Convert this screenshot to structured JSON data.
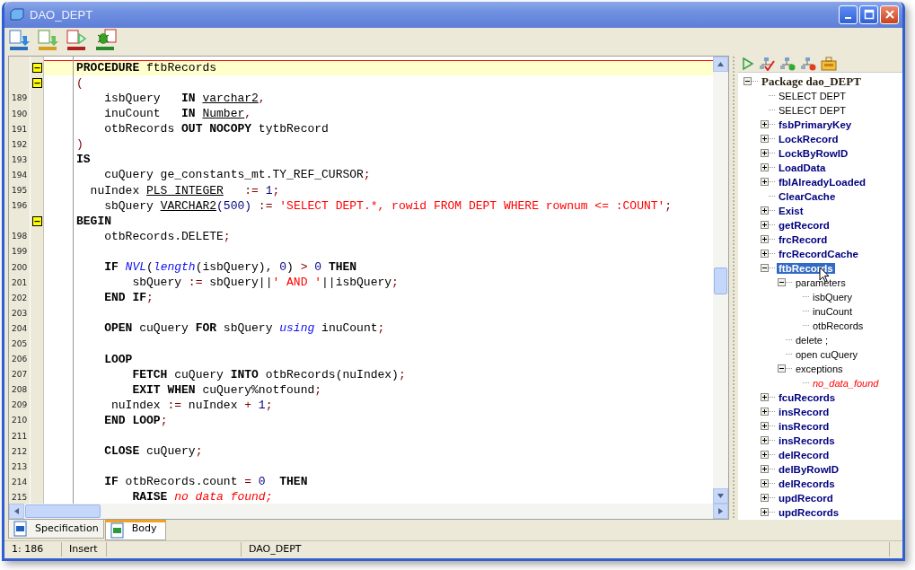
{
  "window": {
    "title": "DAO_DEPT"
  },
  "editor": {
    "lines": [
      {
        "fold": true,
        "current": true,
        "tokens": [
          {
            "kind": "keyword",
            "t": "PROCEDURE"
          },
          {
            "kind": "identifier",
            "t": " ftbRecords"
          }
        ]
      },
      {
        "fold": true,
        "current": false,
        "tokens": [
          {
            "kind": "operator",
            "t": "("
          }
        ]
      },
      {
        "number": "189",
        "tokens": [
          {
            "kind": "identifier",
            "t": "    isbQuery   "
          },
          {
            "kind": "keyword",
            "t": "IN "
          },
          {
            "kind": "datatype",
            "t": "varchar2"
          },
          {
            "kind": "operator",
            "t": ","
          }
        ]
      },
      {
        "number": "190",
        "tokens": [
          {
            "kind": "identifier",
            "t": "    inuCount   "
          },
          {
            "kind": "keyword",
            "t": "IN "
          },
          {
            "kind": "datatype",
            "t": "Number"
          },
          {
            "kind": "operator",
            "t": ","
          }
        ]
      },
      {
        "number": "191",
        "tokens": [
          {
            "kind": "identifier",
            "t": "    otbRecords "
          },
          {
            "kind": "keyword",
            "t": "OUT NOCOPY"
          },
          {
            "kind": "identifier",
            "t": " tytbRecord"
          }
        ]
      },
      {
        "number": "192",
        "tokens": [
          {
            "kind": "operator",
            "t": ")"
          }
        ]
      },
      {
        "number": "193",
        "tokens": [
          {
            "kind": "keyword",
            "t": "IS"
          }
        ]
      },
      {
        "number": "194",
        "tokens": [
          {
            "kind": "identifier",
            "t": "    cuQuery ge_constants_mt.TY_REF_CURSOR"
          },
          {
            "kind": "operator",
            "t": ";"
          }
        ]
      },
      {
        "number": "195",
        "tokens": [
          {
            "kind": "identifier",
            "t": "  nuIndex "
          },
          {
            "kind": "datatype",
            "t": "PLS_INTEGER"
          },
          {
            "kind": "operator",
            "t": "   := "
          },
          {
            "kind": "number",
            "t": "1"
          },
          {
            "kind": "operator",
            "t": ";"
          }
        ]
      },
      {
        "number": "196",
        "tokens": [
          {
            "kind": "identifier",
            "t": "    sbQuery "
          },
          {
            "kind": "datatype",
            "t": "VARCHAR2"
          },
          {
            "kind": "number",
            "t": "(500)"
          },
          {
            "kind": "operator",
            "t": " := "
          },
          {
            "kind": "string",
            "t": "'SELECT DEPT.*, rowid FROM DEPT WHERE rownum <= :COUNT'"
          },
          {
            "kind": "operator",
            "t": ";"
          }
        ]
      },
      {
        "fold": true,
        "current": false,
        "tokens": [
          {
            "kind": "keyword",
            "t": "BEGIN"
          }
        ]
      },
      {
        "number": "198",
        "tokens": [
          {
            "kind": "identifier",
            "t": "    otbRecords.DELETE"
          },
          {
            "kind": "operator",
            "t": ";"
          }
        ]
      },
      {
        "number": "199"
      },
      {
        "number": "200",
        "tokens": [
          {
            "kind": "keyword",
            "t": "    IF "
          },
          {
            "kind": "function",
            "t": "NVL"
          },
          {
            "kind": "identifier",
            "t": "("
          },
          {
            "kind": "function",
            "t": "length"
          },
          {
            "kind": "identifier",
            "t": "(isbQuery), "
          },
          {
            "kind": "number",
            "t": "0"
          },
          {
            "kind": "identifier",
            "t": ") "
          },
          {
            "kind": "operator",
            "t": "> "
          },
          {
            "kind": "number",
            "t": "0 "
          },
          {
            "kind": "keyword",
            "t": "THEN"
          }
        ]
      },
      {
        "number": "201",
        "tokens": [
          {
            "kind": "identifier",
            "t": "        sbQuery "
          },
          {
            "kind": "operator",
            "t": ":="
          },
          {
            "kind": "identifier",
            "t": " sbQuery||"
          },
          {
            "kind": "string",
            "t": "' AND '"
          },
          {
            "kind": "identifier",
            "t": "||isbQuery"
          },
          {
            "kind": "operator",
            "t": ";"
          }
        ]
      },
      {
        "number": "202",
        "tokens": [
          {
            "kind": "keyword",
            "t": "    END IF"
          },
          {
            "kind": "operator",
            "t": ";"
          }
        ]
      },
      {
        "number": "203"
      },
      {
        "number": "204",
        "tokens": [
          {
            "kind": "keyword",
            "t": "    OPEN"
          },
          {
            "kind": "identifier",
            "t": " cuQuery "
          },
          {
            "kind": "keyword",
            "t": "FOR"
          },
          {
            "kind": "identifier",
            "t": " sbQuery "
          },
          {
            "kind": "function",
            "t": "using"
          },
          {
            "kind": "identifier",
            "t": " inuCount"
          },
          {
            "kind": "operator",
            "t": ";"
          }
        ]
      },
      {
        "number": "205"
      },
      {
        "number": "206",
        "tokens": [
          {
            "kind": "keyword",
            "t": "    LOOP"
          }
        ]
      },
      {
        "number": "207",
        "tokens": [
          {
            "kind": "keyword",
            "t": "        FETCH"
          },
          {
            "kind": "identifier",
            "t": " cuQuery "
          },
          {
            "kind": "keyword",
            "t": "INTO"
          },
          {
            "kind": "identifier",
            "t": " otbRecords(nuIndex)"
          },
          {
            "kind": "operator",
            "t": ";"
          }
        ]
      },
      {
        "number": "208",
        "tokens": [
          {
            "kind": "keyword",
            "t": "        EXIT WHEN"
          },
          {
            "kind": "identifier",
            "t": " cuQuery%notfound"
          },
          {
            "kind": "operator",
            "t": ";"
          }
        ]
      },
      {
        "number": "209",
        "tokens": [
          {
            "kind": "identifier",
            "t": "     nuIndex "
          },
          {
            "kind": "operator",
            "t": ":="
          },
          {
            "kind": "identifier",
            "t": " nuIndex "
          },
          {
            "kind": "operator",
            "t": "+ "
          },
          {
            "kind": "number",
            "t": "1"
          },
          {
            "kind": "operator",
            "t": ";"
          }
        ]
      },
      {
        "number": "210",
        "tokens": [
          {
            "kind": "keyword",
            "t": "    END LOOP"
          },
          {
            "kind": "operator",
            "t": ";"
          }
        ]
      },
      {
        "number": "211"
      },
      {
        "number": "212",
        "tokens": [
          {
            "kind": "keyword",
            "t": "    CLOSE"
          },
          {
            "kind": "identifier",
            "t": " cuQuery"
          },
          {
            "kind": "operator",
            "t": ";"
          }
        ]
      },
      {
        "number": "213"
      },
      {
        "number": "214",
        "tokens": [
          {
            "kind": "keyword",
            "t": "    IF"
          },
          {
            "kind": "identifier",
            "t": " otbRecords.count "
          },
          {
            "kind": "operator",
            "t": "= "
          },
          {
            "kind": "number",
            "t": "0  "
          },
          {
            "kind": "keyword",
            "t": "THEN"
          }
        ]
      },
      {
        "number": "215",
        "tokens": [
          {
            "kind": "keyword",
            "t": "        RAISE "
          },
          {
            "kind": "exception",
            "t": "no data found;"
          }
        ]
      }
    ]
  },
  "tree": {
    "root": {
      "label": "Package dao_DEPT",
      "expanded": true,
      "children": [
        {
          "label": "SELECT DEPT",
          "kind": "plain",
          "selected": false
        },
        {
          "label": "SELECT DEPT",
          "kind": "plain",
          "selected": false
        },
        {
          "label": "fsbPrimaryKey",
          "kind": "method",
          "expanded": false,
          "selected": false
        },
        {
          "label": "LockRecord",
          "kind": "method",
          "expanded": false,
          "selected": false
        },
        {
          "label": "LockByRowID",
          "kind": "method",
          "expanded": false,
          "selected": false
        },
        {
          "label": "LoadData",
          "kind": "method",
          "expanded": false,
          "selected": false
        },
        {
          "label": "fblAlreadyLoaded",
          "kind": "method",
          "expanded": false,
          "selected": false
        },
        {
          "label": "ClearCache",
          "kind": "method",
          "selected": false
        },
        {
          "label": "Exist",
          "kind": "method",
          "expanded": false,
          "selected": false
        },
        {
          "label": "getRecord",
          "kind": "method",
          "expanded": false,
          "selected": false
        },
        {
          "label": "frcRecord",
          "kind": "method",
          "expanded": false,
          "selected": false
        },
        {
          "label": "frcRecordCache",
          "kind": "method",
          "expanded": false,
          "selected": false
        },
        {
          "label": "ftbRecords",
          "kind": "method",
          "expanded": true,
          "selected": true,
          "children": [
            {
              "label": "parameters",
              "kind": "plain",
              "expanded": true,
              "selected": false,
              "children": [
                {
                  "label": "isbQuery",
                  "kind": "plain",
                  "selected": false
                },
                {
                  "label": "inuCount",
                  "kind": "plain",
                  "selected": false
                },
                {
                  "label": "otbRecords",
                  "kind": "plain",
                  "selected": false
                }
              ]
            },
            {
              "label": "delete ;",
              "kind": "plain",
              "selected": false
            },
            {
              "label": "open cuQuery",
              "kind": "plain",
              "selected": false
            },
            {
              "label": "exceptions",
              "kind": "plain",
              "expanded": true,
              "selected": false,
              "children": [
                {
                  "label": "no_data_found",
                  "kind": "error",
                  "selected": false
                }
              ]
            }
          ]
        },
        {
          "label": "fcuRecords",
          "kind": "method",
          "expanded": false,
          "selected": false
        },
        {
          "label": "insRecord",
          "kind": "method",
          "expanded": false,
          "selected": false
        },
        {
          "label": "insRecord",
          "kind": "method",
          "expanded": false,
          "selected": false
        },
        {
          "label": "insRecords",
          "kind": "method",
          "expanded": false,
          "selected": false
        },
        {
          "label": "delRecord",
          "kind": "method",
          "expanded": false,
          "selected": false
        },
        {
          "label": "delByRowID",
          "kind": "method",
          "expanded": false,
          "selected": false
        },
        {
          "label": "delRecords",
          "kind": "method",
          "expanded": false,
          "selected": false
        },
        {
          "label": "updRecord",
          "kind": "method",
          "expanded": false,
          "selected": false
        },
        {
          "label": "updRecords",
          "kind": "method",
          "expanded": false,
          "selected": false
        }
      ]
    }
  },
  "tabs": [
    {
      "label": "Specification",
      "selected": false
    },
    {
      "label": "Body",
      "selected": true
    }
  ],
  "status_bar": [
    "1: 186",
    "Insert",
    "DAO_DEPT"
  ]
}
